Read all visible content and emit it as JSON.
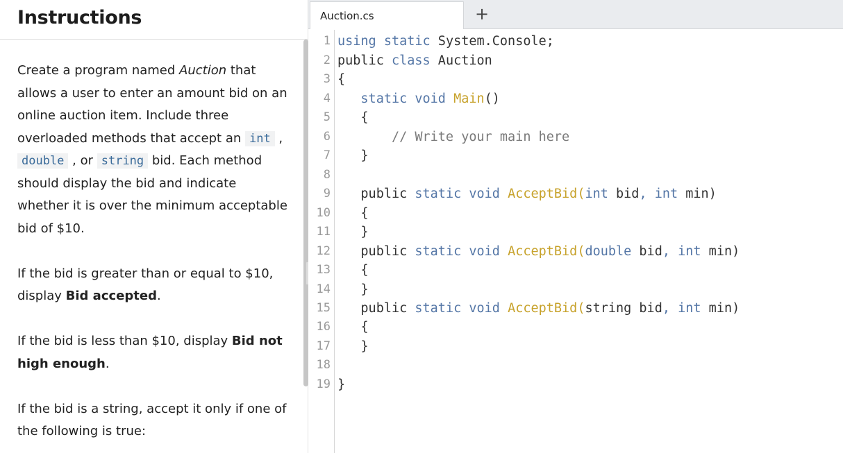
{
  "instructions": {
    "title": "Instructions",
    "paragraphs": [
      {
        "runs": [
          {
            "t": "text",
            "v": "Create a program named "
          },
          {
            "t": "italic",
            "v": "Auction"
          },
          {
            "t": "text",
            "v": " that allows a user to enter an amount bid on an online auction item. Include three overloaded methods that accept an "
          },
          {
            "t": "code",
            "v": "int"
          },
          {
            "t": "text",
            "v": " , "
          },
          {
            "t": "code",
            "v": "double"
          },
          {
            "t": "text",
            "v": " , or "
          },
          {
            "t": "code",
            "v": "string"
          },
          {
            "t": "text",
            "v": " bid. Each method should display the bid and indicate whether it is over the minimum acceptable bid of $10."
          }
        ]
      },
      {
        "runs": [
          {
            "t": "text",
            "v": "If the bid is greater than or equal to $10, display "
          },
          {
            "t": "bold",
            "v": "Bid accepted"
          },
          {
            "t": "text",
            "v": "."
          }
        ]
      },
      {
        "runs": [
          {
            "t": "text",
            "v": "If the bid is less than $10, display "
          },
          {
            "t": "bold",
            "v": "Bid not high enough"
          },
          {
            "t": "text",
            "v": "."
          }
        ]
      },
      {
        "runs": [
          {
            "t": "text",
            "v": "If the bid is a string, accept it only if one of the following is true:"
          }
        ]
      }
    ]
  },
  "editor": {
    "tab_label": "Auction.cs",
    "new_tab_label": "+",
    "line_numbers": [
      "1",
      "2",
      "3",
      "4",
      "5",
      "6",
      "7",
      "8",
      "9",
      "10",
      "11",
      "12",
      "13",
      "14",
      "15",
      "16",
      "17",
      "18",
      "19"
    ],
    "lines": [
      [
        {
          "c": "kw",
          "v": "using"
        },
        {
          "c": "tx",
          "v": " "
        },
        {
          "c": "kw",
          "v": "static"
        },
        {
          "c": "tx",
          "v": " System.Console;"
        }
      ],
      [
        {
          "c": "tx",
          "v": "public "
        },
        {
          "c": "kw",
          "v": "class"
        },
        {
          "c": "tx",
          "v": " Auction"
        }
      ],
      [
        {
          "c": "tx",
          "v": "{"
        }
      ],
      [
        {
          "c": "tx",
          "v": "   "
        },
        {
          "c": "kw",
          "v": "static"
        },
        {
          "c": "tx",
          "v": " "
        },
        {
          "c": "kw",
          "v": "void"
        },
        {
          "c": "tx",
          "v": " "
        },
        {
          "c": "fn",
          "v": "Main"
        },
        {
          "c": "tx",
          "v": "()"
        }
      ],
      [
        {
          "c": "tx",
          "v": "   {"
        }
      ],
      [
        {
          "c": "tx",
          "v": "       "
        },
        {
          "c": "cm",
          "v": "// Write your main here"
        }
      ],
      [
        {
          "c": "tx",
          "v": "   }"
        }
      ],
      [],
      [
        {
          "c": "tx",
          "v": "   public "
        },
        {
          "c": "kw",
          "v": "static"
        },
        {
          "c": "tx",
          "v": " "
        },
        {
          "c": "kw",
          "v": "void"
        },
        {
          "c": "tx",
          "v": " "
        },
        {
          "c": "fn",
          "v": "AcceptBid"
        },
        {
          "c": "fn",
          "v": "("
        },
        {
          "c": "kw",
          "v": "int"
        },
        {
          "c": "tx",
          "v": " bid"
        },
        {
          "c": "kw",
          "v": ","
        },
        {
          "c": "tx",
          "v": " "
        },
        {
          "c": "kw",
          "v": "int"
        },
        {
          "c": "tx",
          "v": " min)"
        }
      ],
      [
        {
          "c": "tx",
          "v": "   {"
        }
      ],
      [
        {
          "c": "tx",
          "v": "   }"
        }
      ],
      [
        {
          "c": "tx",
          "v": "   public "
        },
        {
          "c": "kw",
          "v": "static"
        },
        {
          "c": "tx",
          "v": " "
        },
        {
          "c": "kw",
          "v": "void"
        },
        {
          "c": "tx",
          "v": " "
        },
        {
          "c": "fn",
          "v": "AcceptBid"
        },
        {
          "c": "fn",
          "v": "("
        },
        {
          "c": "kw",
          "v": "double"
        },
        {
          "c": "tx",
          "v": " bid"
        },
        {
          "c": "kw",
          "v": ","
        },
        {
          "c": "tx",
          "v": " "
        },
        {
          "c": "kw",
          "v": "int"
        },
        {
          "c": "tx",
          "v": " min)"
        }
      ],
      [
        {
          "c": "tx",
          "v": "   {"
        }
      ],
      [
        {
          "c": "tx",
          "v": "   }"
        }
      ],
      [
        {
          "c": "tx",
          "v": "   public "
        },
        {
          "c": "kw",
          "v": "static"
        },
        {
          "c": "tx",
          "v": " "
        },
        {
          "c": "kw",
          "v": "void"
        },
        {
          "c": "tx",
          "v": " "
        },
        {
          "c": "fn",
          "v": "AcceptBid"
        },
        {
          "c": "fn",
          "v": "("
        },
        {
          "c": "tx",
          "v": "string bid"
        },
        {
          "c": "kw",
          "v": ","
        },
        {
          "c": "tx",
          "v": " "
        },
        {
          "c": "kw",
          "v": "int"
        },
        {
          "c": "tx",
          "v": " min)"
        }
      ],
      [
        {
          "c": "tx",
          "v": "   {"
        }
      ],
      [
        {
          "c": "tx",
          "v": "   }"
        }
      ],
      [],
      [
        {
          "c": "tx",
          "v": "}"
        }
      ]
    ]
  },
  "colors": {
    "keyword": "#5476a6",
    "function": "#c7a22b",
    "comment": "#7a7a7a",
    "text": "#333333"
  }
}
